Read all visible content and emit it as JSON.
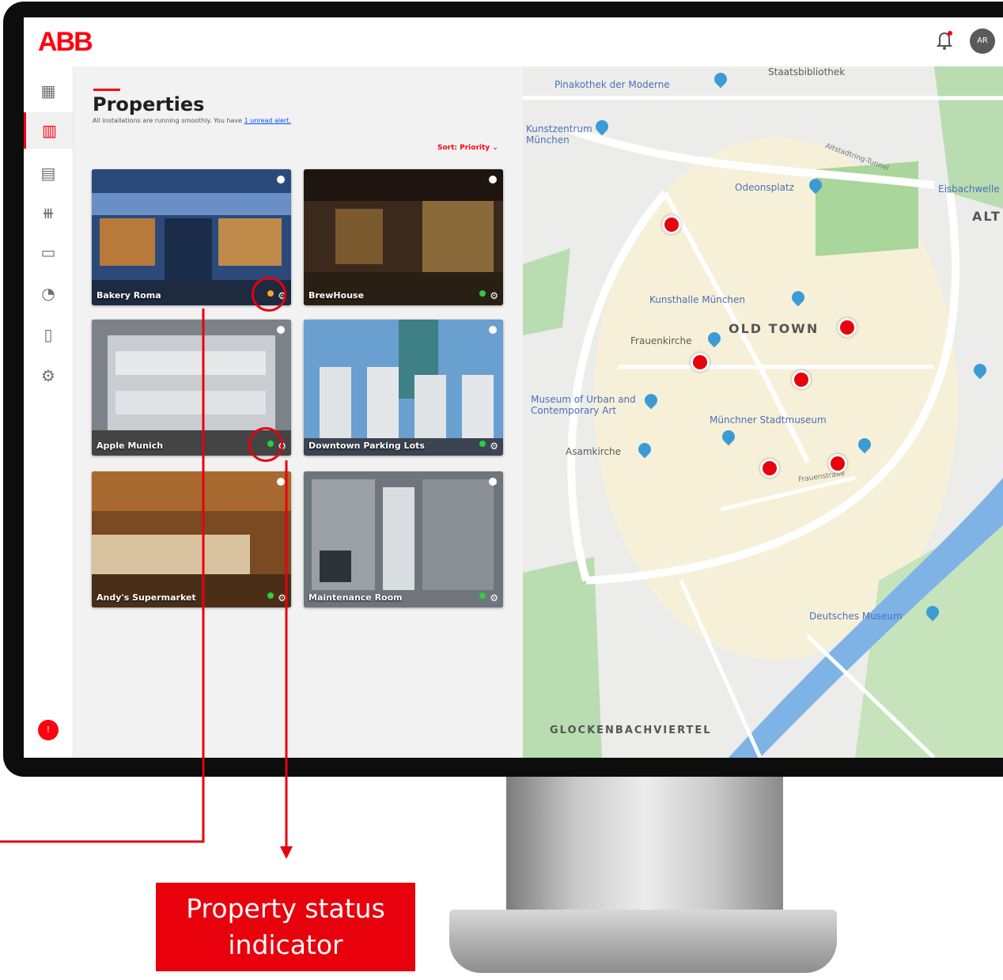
{
  "app": {
    "logo": "ABB",
    "user_initials": "AR",
    "nav_badge": "!"
  },
  "nav": {
    "items": [
      {
        "icon": "dashboard-icon",
        "glyph": "▦"
      },
      {
        "icon": "buildings-icon",
        "glyph": "▥"
      },
      {
        "icon": "devices-icon",
        "glyph": "▤"
      },
      {
        "icon": "sliders-icon",
        "glyph": "⧻"
      },
      {
        "icon": "folder-icon",
        "glyph": "▭"
      },
      {
        "icon": "energy-icon",
        "glyph": "◔"
      },
      {
        "icon": "document-icon",
        "glyph": "▯"
      },
      {
        "icon": "settings-icon",
        "glyph": "⚙"
      }
    ]
  },
  "properties": {
    "title": "Properties",
    "subtitle": "All installations are running smoothly. You have",
    "subtitle_link": "1 unread alert.",
    "sort_label": "Sort: Priority ⌄",
    "cards": [
      {
        "name": "Bakery Roma",
        "status": "warning",
        "status_color": "#f5a623",
        "bg": "#2b4a7a"
      },
      {
        "name": "BrewHouse",
        "status": "ok",
        "status_color": "#2ecc40",
        "bg": "#3b2a1c"
      },
      {
        "name": "Apple Munich",
        "status": "ok",
        "status_color": "#2ecc40",
        "bg": "#7d8289"
      },
      {
        "name": "Downtown Parking Lots",
        "status": "ok",
        "status_color": "#2ecc40",
        "bg": "#4f7fa8"
      },
      {
        "name": "Andy's Supermarket",
        "status": "ok",
        "status_color": "#2ecc40",
        "bg": "#7a4a22"
      },
      {
        "name": "Maintenance Room",
        "status": "ok",
        "status_color": "#2ecc40",
        "bg": "#6f757c"
      }
    ]
  },
  "map": {
    "labels": [
      {
        "text": "Staatsbibliothek",
        "kind": "place"
      },
      {
        "text": "Pinakothek der Moderne",
        "kind": "poi"
      },
      {
        "text": "Kunstzentrum München",
        "kind": "poi"
      },
      {
        "text": "Altstadtring-Tunnel",
        "kind": "street"
      },
      {
        "text": "Odeonsplatz",
        "kind": "poi"
      },
      {
        "text": "Eisbachwelle",
        "kind": "poi"
      },
      {
        "text": "ALT",
        "kind": "big"
      },
      {
        "text": "Kunsthalle München",
        "kind": "poi"
      },
      {
        "text": "OLD TOWN",
        "kind": "big"
      },
      {
        "text": "Frauenkirche",
        "kind": "place"
      },
      {
        "text": "Museum of Urban and Contemporary Art",
        "kind": "poi"
      },
      {
        "text": "Münchner Stadtmuseum",
        "kind": "poi"
      },
      {
        "text": "Asamkirche",
        "kind": "place"
      },
      {
        "text": "Frauenstraße",
        "kind": "street"
      },
      {
        "text": "Deutsches Museum",
        "kind": "poi"
      },
      {
        "text": "GLOCKENBACHVIERTEL",
        "kind": "big"
      }
    ]
  },
  "annotation": {
    "callout": "Property status indicator"
  }
}
